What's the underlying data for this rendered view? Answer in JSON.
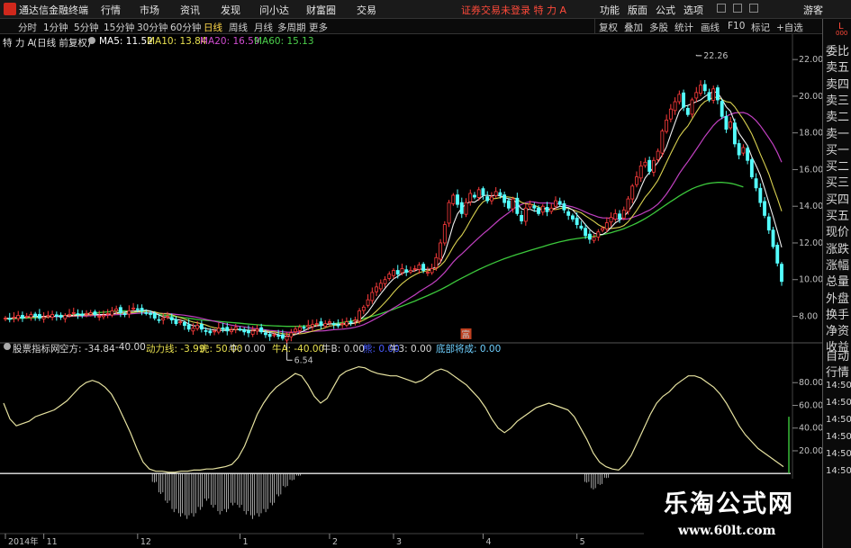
{
  "titlebar": {
    "app": "通达信金融终端",
    "menus": [
      "行情",
      "市场",
      "资讯",
      "发现",
      "问小达",
      "财富圈",
      "交易"
    ],
    "alert": "证券交易未登录 特 力 A",
    "right": [
      "功能",
      "版面",
      "公式",
      "选项",
      "游客"
    ]
  },
  "periods": [
    "分时",
    "1分钟",
    "5分钟",
    "15分钟",
    "30分钟",
    "60分钟",
    "日线",
    "周线",
    "月线",
    "多周期",
    "更多"
  ],
  "active_period": "日线",
  "tools": [
    "复权",
    "叠加",
    "多股",
    "统计",
    "画线",
    "F10",
    "标记",
    "+自选"
  ],
  "info": {
    "stock": "特 力 A",
    "mode": "(日线 前复权)",
    "ma5": "MA5: 11.52",
    "ma10": "MA10: 13.84",
    "ma20": "MA20: 16.59",
    "ma60": "MA60: 15.13"
  },
  "indicator": {
    "name": "股票指标网",
    "values": [
      {
        "text": "空方: -34.84",
        "color": "#d8d8d8"
      },
      {
        "text": "-40.00",
        "color": "#d8d8d8"
      },
      {
        "text": "动力线: -3.99",
        "color": "#e8e050"
      },
      {
        "text": "虎: 50.00",
        "color": "#e8e050"
      },
      {
        "text": "牛: 0.00",
        "color": "#d8d8d8"
      },
      {
        "text": "牛A: -40.00",
        "color": "#e8e050"
      },
      {
        "text": "牛B: 0.00",
        "color": "#d8d8d8"
      },
      {
        "text": "熊: 0.00",
        "color": "#4a5cff"
      },
      {
        "text": "牛3: 0.00",
        "color": "#d8d8d8"
      },
      {
        "text": "底部将成: 0.00",
        "color": "#6fd0ff"
      }
    ]
  },
  "right_panel": {
    "header_top": "L",
    "header_bottom": "000",
    "items": [
      "委比",
      "卖五",
      "卖四",
      "卖三",
      "卖二",
      "卖一",
      "买一",
      "买二",
      "买三",
      "买四",
      "买五",
      "现价",
      "涨跌",
      "涨幅",
      "总量",
      "外盘",
      "换手",
      "净资",
      "收益"
    ],
    "lower_items": [
      "自动",
      "行情"
    ],
    "times": [
      "14:50",
      "14:50",
      "14:50",
      "14:50",
      "14:50",
      "14:50"
    ]
  },
  "watermark": {
    "title": "乐淘公式网",
    "url": "www.60lt.com"
  },
  "chart_data": {
    "type": "candlestick",
    "price_axis": {
      "ticks": [
        8.0,
        10.0,
        12.0,
        14.0,
        16.0,
        18.0,
        20.0,
        22.0
      ],
      "labels": [
        "8.00",
        "10.00",
        "12.00",
        "14.00",
        "16.00",
        "18.00",
        "20.00",
        "22.00"
      ],
      "ylim": [
        6.7,
        22.4
      ]
    },
    "osc_axis": {
      "ticks": [
        20.0,
        40.0,
        60.0,
        80.0
      ],
      "labels": [
        "20.00",
        "40.00",
        "60.00",
        "80.00"
      ],
      "ylim": [
        -45,
        100
      ]
    },
    "date_axis": [
      {
        "i": 0,
        "label": "2014年"
      },
      {
        "i": 9,
        "label": "11"
      },
      {
        "i": 31,
        "label": "12"
      },
      {
        "i": 55,
        "label": "1"
      },
      {
        "i": 76,
        "label": "2"
      },
      {
        "i": 91,
        "label": "3"
      },
      {
        "i": 112,
        "label": "4"
      },
      {
        "i": 134,
        "label": "5"
      }
    ],
    "annotations": [
      {
        "text": "22.26",
        "i": 162,
        "value": 22.26
      },
      {
        "text": "6.54",
        "i": 66,
        "value": 6.54
      },
      {
        "text": "富",
        "i": 108
      }
    ],
    "close_series": [
      7.9,
      7.85,
      7.95,
      8.05,
      7.9,
      8.0,
      8.1,
      8.0,
      7.9,
      7.95,
      8.05,
      8.1,
      8.0,
      7.95,
      8.05,
      8.1,
      8.2,
      8.1,
      8.05,
      8.15,
      8.2,
      8.1,
      8.0,
      8.05,
      8.15,
      8.3,
      8.4,
      8.2,
      8.1,
      8.3,
      8.45,
      8.4,
      8.3,
      8.2,
      8.1,
      7.9,
      7.8,
      7.9,
      8.0,
      7.8,
      7.6,
      7.7,
      7.5,
      7.3,
      7.35,
      7.5,
      7.3,
      7.2,
      7.1,
      7.2,
      7.35,
      7.3,
      7.2,
      7.25,
      7.4,
      7.3,
      7.15,
      7.1,
      7.2,
      7.3,
      7.15,
      7.0,
      6.9,
      7.0,
      6.95,
      6.8,
      6.9,
      7.1,
      7.3,
      7.4,
      7.35,
      7.5,
      7.55,
      7.6,
      7.5,
      7.6,
      7.7,
      7.55,
      7.5,
      7.6,
      7.7,
      7.65,
      7.8,
      8.3,
      8.5,
      8.9,
      9.3,
      9.6,
      9.8,
      10.0,
      10.3,
      10.5,
      10.3,
      10.6,
      10.4,
      10.5,
      10.6,
      10.8,
      10.5,
      10.4,
      10.6,
      11.2,
      12.0,
      13.0,
      14.2,
      14.6,
      14.1,
      13.6,
      14.2,
      14.7,
      14.5,
      14.9,
      14.6,
      14.3,
      14.5,
      14.8,
      14.6,
      14.2,
      13.9,
      14.4,
      13.6,
      13.2,
      13.9,
      14.1,
      13.9,
      13.6,
      14.0,
      13.7,
      13.9,
      14.3,
      14.1,
      13.8,
      13.5,
      13.3,
      13.0,
      12.8,
      12.4,
      12.2,
      12.3,
      12.6,
      12.8,
      13.1,
      13.4,
      13.6,
      13.3,
      13.8,
      14.4,
      15.1,
      15.6,
      16.2,
      16.4,
      15.9,
      16.5,
      17.0,
      18.1,
      18.7,
      19.3,
      19.7,
      20.1,
      19.4,
      19.0,
      19.8,
      20.2,
      20.6,
      20.3,
      19.8,
      20.4,
      19.8,
      18.9,
      18.2,
      18.6,
      17.4,
      16.8,
      17.2,
      16.5,
      15.6,
      15.0,
      14.2,
      13.5,
      12.7,
      11.8,
      10.9,
      9.9
    ],
    "ma60_series": [
      7.85,
      7.86,
      7.87,
      7.88,
      7.89,
      7.9,
      7.91,
      7.92,
      7.93,
      7.94,
      7.96,
      7.98,
      8.0,
      8.02,
      8.04,
      8.06,
      8.08,
      8.1,
      8.12,
      8.14,
      8.16,
      8.18,
      8.2,
      8.22,
      8.24,
      8.26,
      8.28,
      8.3,
      8.3,
      8.29,
      8.27,
      8.25,
      8.22,
      8.19,
      8.16,
      8.13,
      8.1,
      8.07,
      8.04,
      8.01,
      7.98,
      7.95,
      7.92,
      7.89,
      7.86,
      7.83,
      7.8,
      7.78,
      7.76,
      7.74,
      7.72,
      7.7,
      7.68,
      7.66,
      7.64,
      7.62,
      7.6,
      7.58,
      7.56,
      7.54,
      7.52,
      7.5,
      7.49,
      7.48,
      7.47,
      7.46,
      7.45,
      7.45,
      7.45,
      7.46,
      7.47,
      7.48,
      7.5,
      7.52,
      7.54,
      7.56,
      7.58,
      7.6,
      7.63,
      7.66,
      7.7,
      7.74,
      7.78,
      7.83,
      7.88,
      7.94,
      8.0,
      8.07,
      8.14,
      8.22,
      8.3,
      8.38,
      8.47,
      8.56,
      8.65,
      8.74,
      8.83,
      8.93,
      9.03,
      9.13,
      9.23,
      9.34,
      9.45,
      9.57,
      9.7,
      9.83,
      9.96,
      10.08,
      10.2,
      10.32,
      10.44,
      10.55,
      10.66,
      10.76,
      10.86,
      10.96,
      11.05,
      11.14,
      11.22,
      11.3,
      11.38,
      11.45,
      11.52,
      11.59,
      11.66,
      11.73,
      11.8,
      11.87,
      11.94,
      12.0,
      12.06,
      12.11,
      12.16,
      12.2,
      12.24,
      12.27,
      12.3,
      12.33,
      12.36,
      12.4,
      12.45,
      12.5,
      12.56,
      12.63,
      12.7,
      12.78,
      12.87,
      12.97,
      13.08,
      13.2,
      13.33,
      13.47,
      13.62,
      13.78,
      13.94,
      14.1,
      14.26,
      14.41,
      14.56,
      14.7,
      14.83,
      14.95,
      15.05,
      15.13,
      15.2,
      15.25,
      15.28,
      15.3,
      15.3,
      15.28,
      15.25,
      15.2,
      15.13,
      15.05
    ],
    "oscillator": [
      62,
      48,
      42,
      44,
      46,
      50,
      52,
      54,
      56,
      60,
      64,
      70,
      76,
      80,
      82,
      80,
      76,
      70,
      60,
      48,
      36,
      22,
      10,
      4,
      2,
      2,
      1,
      1,
      2,
      2,
      3,
      3,
      4,
      4,
      5,
      6,
      8,
      14,
      24,
      38,
      52,
      62,
      70,
      76,
      80,
      84,
      88,
      86,
      78,
      68,
      62,
      66,
      76,
      86,
      90,
      92,
      94,
      93,
      90,
      88,
      87,
      86,
      86,
      84,
      82,
      80,
      82,
      86,
      90,
      92,
      90,
      86,
      82,
      78,
      72,
      66,
      58,
      48,
      40,
      36,
      40,
      46,
      50,
      54,
      58,
      60,
      62,
      60,
      58,
      56,
      50,
      40,
      30,
      18,
      10,
      6,
      4,
      3,
      8,
      16,
      28,
      40,
      52,
      62,
      68,
      72,
      78,
      82,
      86,
      86,
      84,
      80,
      76,
      70,
      62,
      52,
      42,
      34,
      28,
      22,
      18,
      14,
      10,
      6
    ],
    "bottom_bars": [
      0,
      0,
      0,
      0,
      0,
      0,
      0,
      0,
      0,
      0,
      0,
      0,
      0,
      0,
      0,
      0,
      0,
      0,
      0,
      0,
      0,
      0,
      0,
      -8,
      -18,
      -26,
      -34,
      -38,
      -40,
      -38,
      -32,
      -24,
      -30,
      -36,
      -34,
      -28,
      -30,
      -36,
      -40,
      -38,
      -34,
      -28,
      -20,
      -12,
      -6,
      -2,
      0,
      0,
      0,
      0,
      0,
      0,
      0,
      0,
      0,
      0,
      0,
      0,
      0,
      0,
      0,
      0,
      0,
      0,
      0,
      0,
      0,
      0,
      0,
      0,
      0,
      0,
      0,
      0,
      0,
      0,
      0,
      0,
      0,
      0,
      0,
      0,
      0,
      0,
      0,
      0,
      0,
      0,
      0,
      -8,
      -14,
      -10,
      -4,
      0,
      0,
      0,
      0,
      0,
      0,
      0,
      0,
      0,
      0,
      0,
      0,
      0,
      0,
      0,
      0,
      0,
      0,
      0,
      0,
      0,
      0,
      0,
      0,
      0,
      0,
      0
    ]
  }
}
